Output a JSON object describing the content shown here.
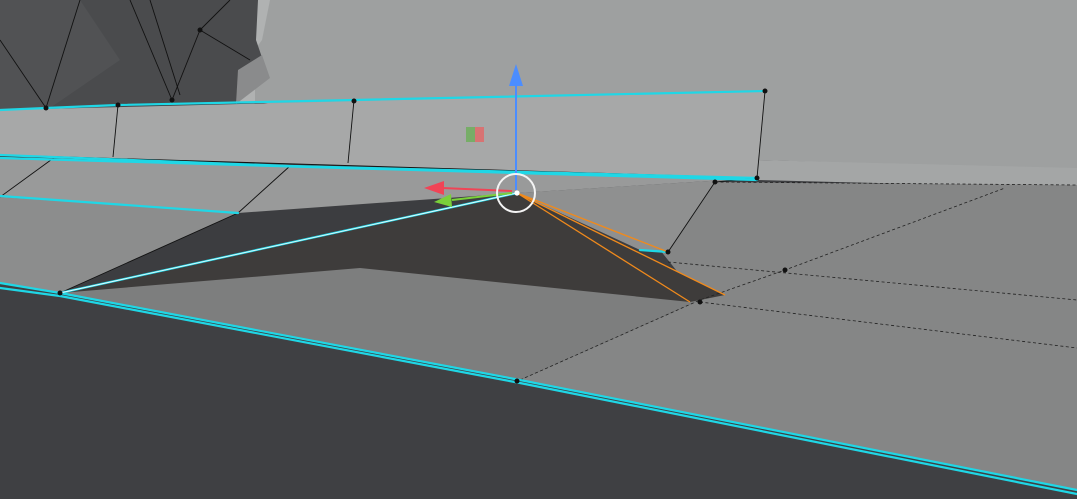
{
  "viewport": {
    "mode": "3d-edit-mode",
    "selection": {
      "element": "vertex",
      "highlight_color": "#f08a1c"
    },
    "gizmo": {
      "type": "move",
      "axes": [
        {
          "axis": "z",
          "icon": "arrow-up-icon",
          "color": "#4b8dff"
        },
        {
          "axis": "x",
          "icon": "arrow-left-icon",
          "color": "#f04456"
        },
        {
          "axis": "y",
          "icon": "arrow-left-icon",
          "color": "#7ad03a"
        }
      ],
      "plane_handle_icon": "plane-handle-icon",
      "pivot_icon": "circle-pivot-icon"
    },
    "colors": {
      "seam": "#1fd7e6",
      "edge": "#111111",
      "vertex": "#111111",
      "background": "#3c3d40"
    }
  }
}
